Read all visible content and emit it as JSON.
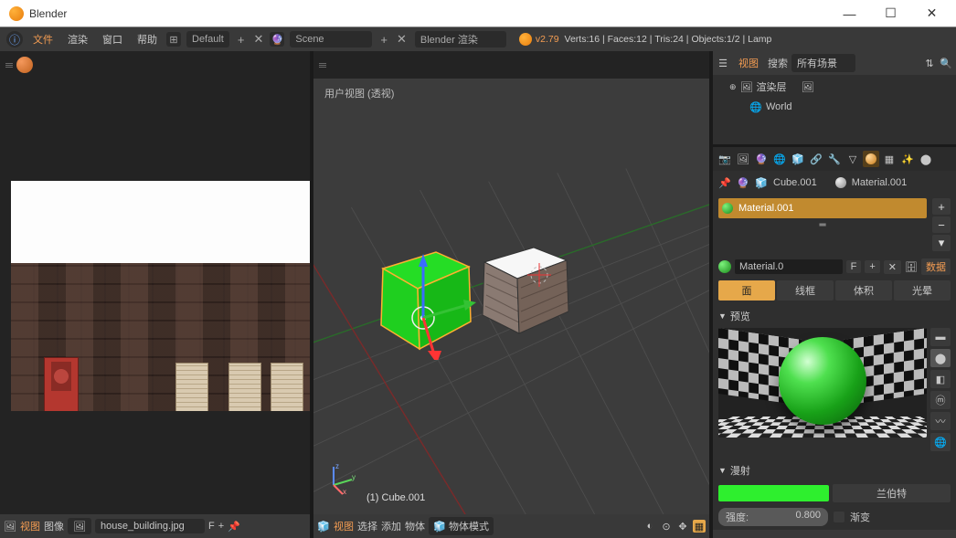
{
  "title": "Blender",
  "menu": {
    "file": "文件",
    "render": "渲染",
    "window": "窗口",
    "help": "帮助",
    "layout": "Default",
    "scene": "Scene",
    "engine": "Blender 渲染"
  },
  "version": "v2.79",
  "stats": "Verts:16 | Faces:12 | Tris:24 | Objects:1/2 | Lamp",
  "uv": {
    "view": "视图",
    "image": "图像",
    "filename": "house_building.jpg",
    "users": "F"
  },
  "v3d": {
    "view_label": "用户视图 (透视)",
    "object_label": "(1) Cube.001",
    "view": "视图",
    "select": "选择",
    "add": "添加",
    "object": "物体",
    "mode": "物体模式"
  },
  "outliner": {
    "view": "视图",
    "search": "搜索",
    "allscenes": "所有场景",
    "renderlayers": "渲染层",
    "world": "World"
  },
  "properties": {
    "breadcrumb_cube": "Cube.001",
    "breadcrumb_mat": "Material.001",
    "slot_mat": "Material.001",
    "mat_name": "Material.0",
    "F": "F",
    "data_btn": "数据",
    "tab_surface": "面",
    "tab_wire": "线框",
    "tab_volume": "体积",
    "tab_halo": "光晕",
    "preview": "预览",
    "diffuse": "漫射",
    "lambert": "兰伯特",
    "intensity_label": "强度:",
    "intensity_val": "0.800",
    "ramp": "渐变"
  }
}
